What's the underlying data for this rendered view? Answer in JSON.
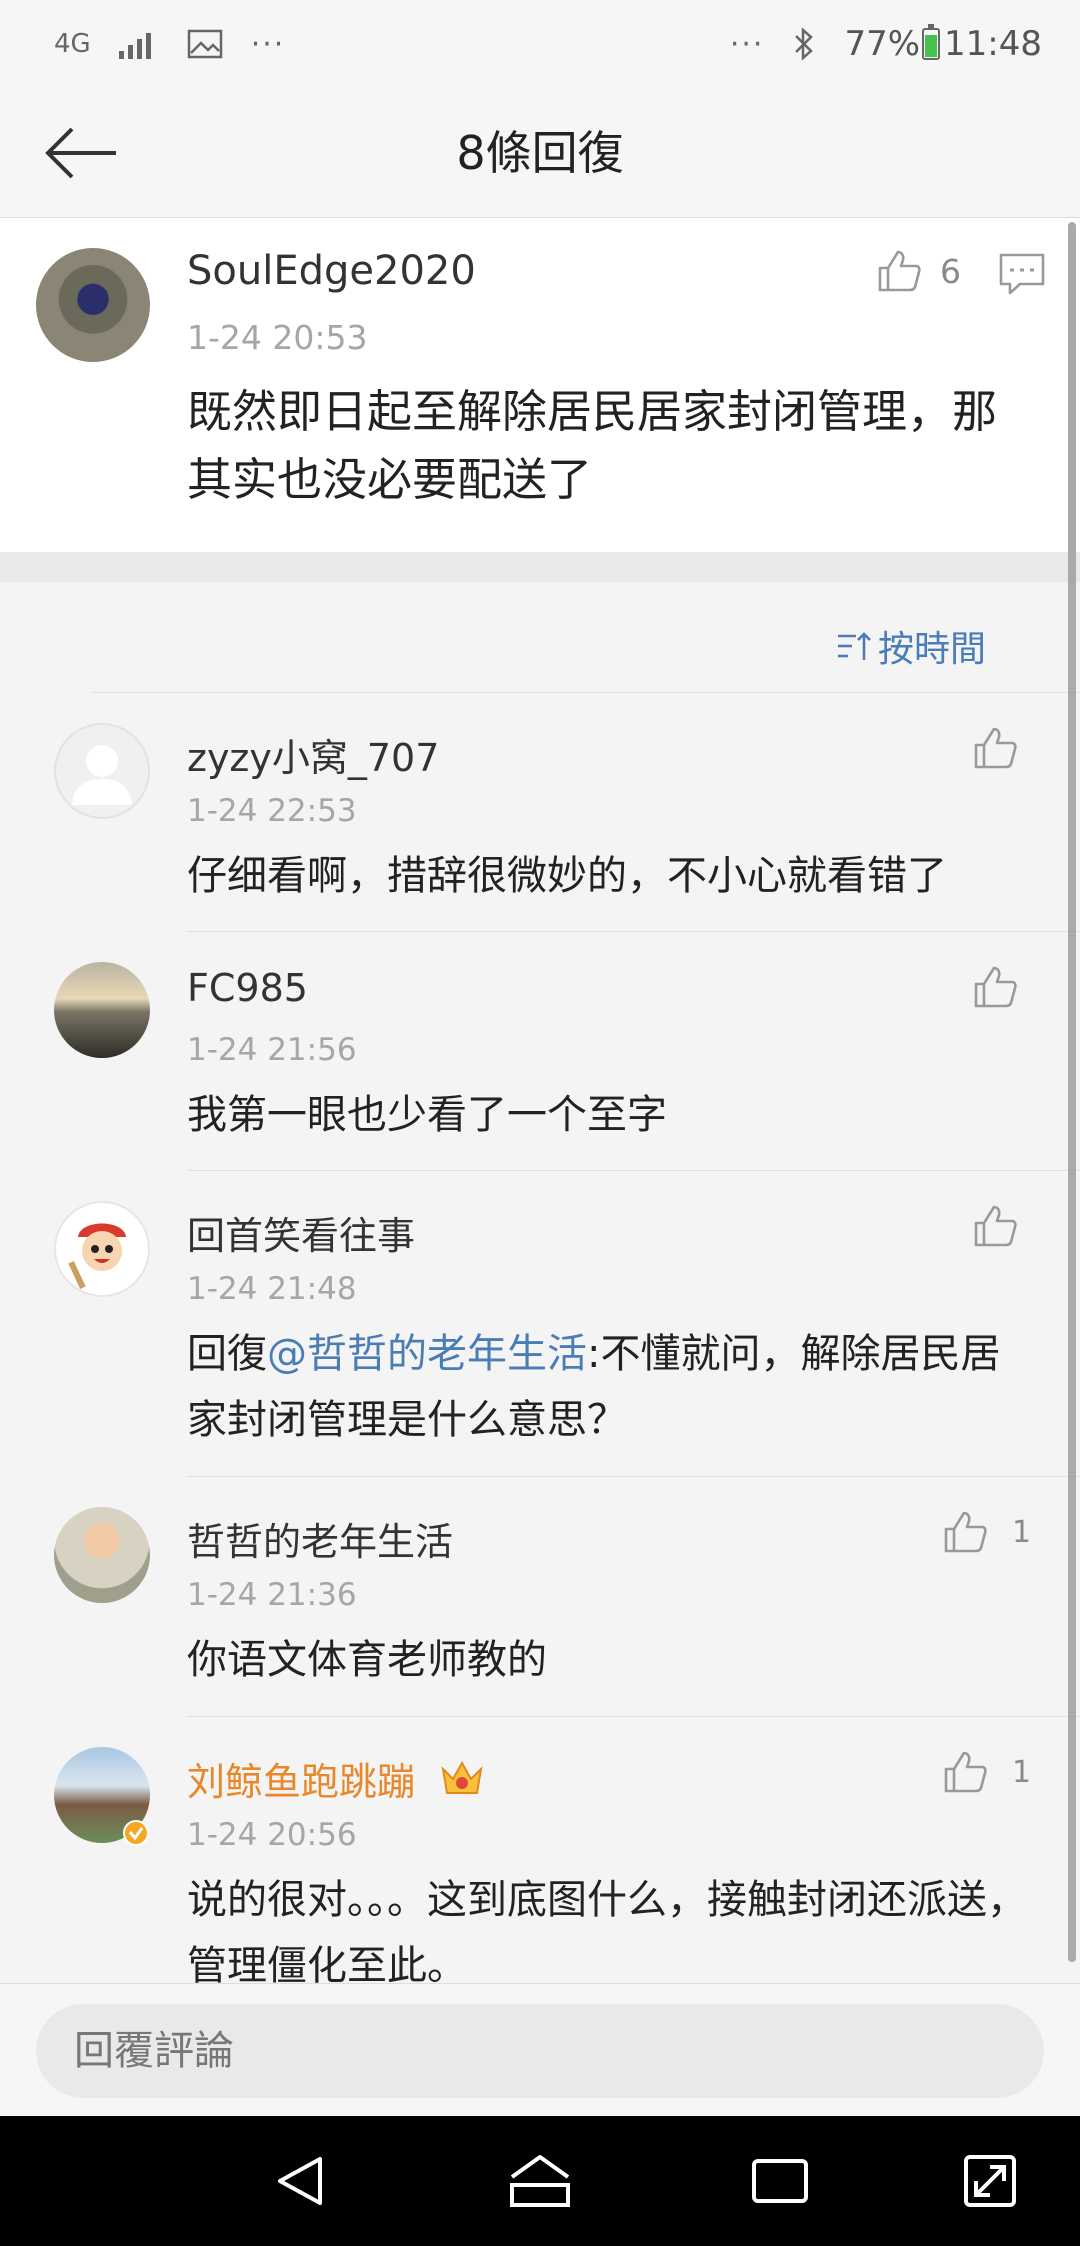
{
  "status_bar": {
    "network": "4G",
    "dots_left": "···",
    "dots_right": "···",
    "battery_percent": "77%",
    "time": "11:48"
  },
  "header": {
    "title": "8條回復"
  },
  "main_comment": {
    "username": "SoulEdge2020",
    "time": "1-24 20:53",
    "like_count": "6",
    "text": "既然即日起至解除居民居家封闭管理，那其实也没必要配送了"
  },
  "sort": {
    "label": "按時間"
  },
  "replies": [
    {
      "username": "zyzy小窝_707",
      "time": "1-24 22:53",
      "text": "仔细看啊，措辞很微妙的，不小心就看错了",
      "like_count": ""
    },
    {
      "username": "FC985",
      "time": "1-24 21:56",
      "text": "我第一眼也少看了一个至字",
      "like_count": ""
    },
    {
      "username": "回首笑看往事",
      "time": "1-24 21:48",
      "reply_prefix": "回復",
      "mention": "@哲哲的老年生活",
      "text": ":不懂就问，解除居民居家封闭管理是什么意思？",
      "like_count": ""
    },
    {
      "username": "哲哲的老年生活",
      "time": "1-24 21:36",
      "text": "你语文体育老师教的",
      "like_count": "1"
    },
    {
      "username": "刘鲸鱼跑跳蹦",
      "time": "1-24 20:56",
      "text": "说的很对。。。这到底图什么，接触封闭还派送，管理僵化至此。",
      "like_count": "1"
    }
  ],
  "input": {
    "placeholder": "回覆評論"
  },
  "colors": {
    "accent": "#4a7db5",
    "vip_name": "#e8882a",
    "battery": "#45c24c"
  }
}
